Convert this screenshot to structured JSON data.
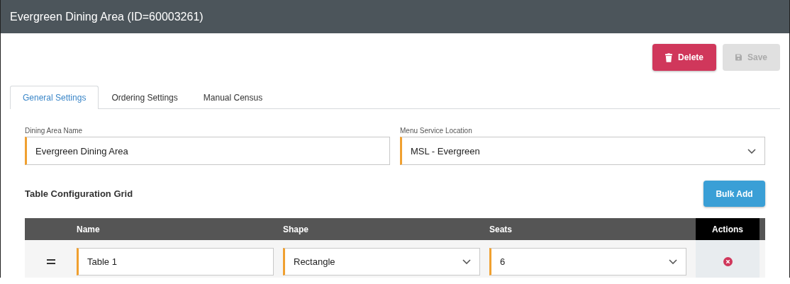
{
  "window": {
    "title": "Evergreen Dining Area (ID=60003261)"
  },
  "actions": [
    {
      "label": "Delete",
      "kind": "delete",
      "disabled": false
    },
    {
      "label": "Save",
      "kind": "save",
      "disabled": true
    }
  ],
  "tabs": [
    {
      "label": "General Settings",
      "selected": true
    },
    {
      "label": "Ordering Settings",
      "selected": false
    },
    {
      "label": "Manual Census",
      "selected": false
    }
  ],
  "fields": [
    {
      "label": "Dining Area Name",
      "value": "Evergreen Dining Area",
      "kind": "text"
    },
    {
      "label": "Menu Service Location",
      "value": "MSL - Evergreen",
      "kind": "select"
    }
  ],
  "grid": {
    "title": "Table Configuration Grid",
    "bulk_add_button": "Bulk Add",
    "columns": [
      "Name",
      "Shape",
      "Seats",
      "Actions"
    ],
    "rows": [
      {
        "name": "Table 1",
        "shape": "Rectangle",
        "seats": "6"
      }
    ]
  }
}
